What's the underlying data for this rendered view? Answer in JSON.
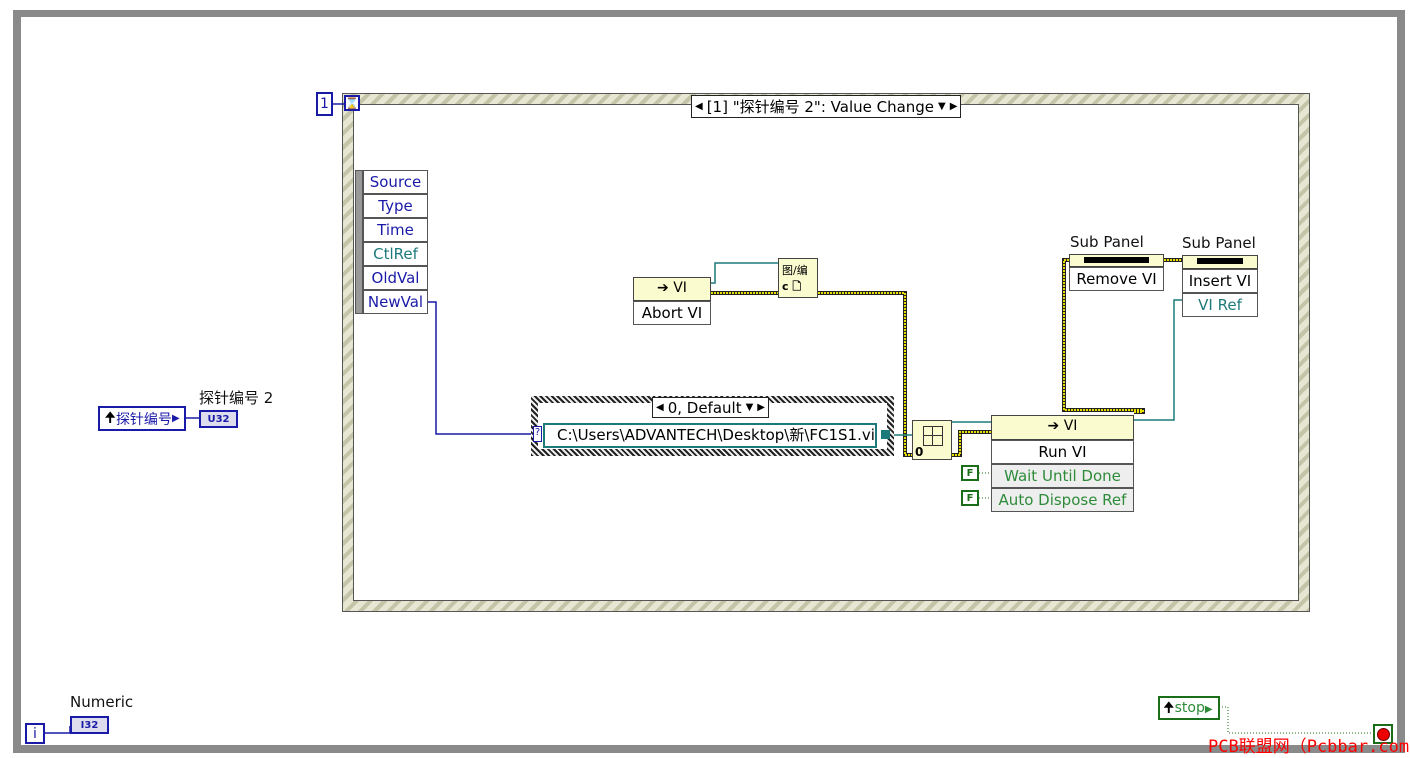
{
  "loop": {
    "count_terminal": "1",
    "iteration_terminal": "i"
  },
  "event_structure": {
    "selector": "[1] \"探针编号 2\": Value Change",
    "event_data": [
      "Source",
      "Type",
      "Time",
      "CtlRef",
      "OldVal",
      "NewVal"
    ]
  },
  "abort_node": {
    "class": "VI",
    "method": "Abort VI"
  },
  "open_ref_node": {
    "glyph": "图/编",
    "sub": "c"
  },
  "case_structure": {
    "selector": "0, Default",
    "path_constant": "C:\\Users\\ADVANTECH\\Desktop\\新\\FC1S1.vi"
  },
  "split_node": {
    "value": "0"
  },
  "run_node": {
    "class": "VI",
    "method": "Run VI",
    "params": [
      "Wait Until Done",
      "Auto Dispose Ref"
    ],
    "constants": [
      "F",
      "F"
    ]
  },
  "remove_node": {
    "label": "Sub Panel",
    "method": "Remove VI"
  },
  "insert_node": {
    "label": "Sub Panel",
    "method": "Insert VI",
    "param": "VI Ref"
  },
  "probe_control": {
    "text": "探针编号",
    "indicator_label": "探针编号 2",
    "indicator_type": "U32"
  },
  "numeric": {
    "label": "Numeric",
    "type": "I32"
  },
  "stop": {
    "text": "stop"
  },
  "watermark": "PCB联盟网（Pcbbar.com）",
  "colors": {
    "u32_wire": "#1a1aa8",
    "ref_wire": "#1d7a7a",
    "error_wire": "#d8d000",
    "bool": "#1a6e1a"
  }
}
